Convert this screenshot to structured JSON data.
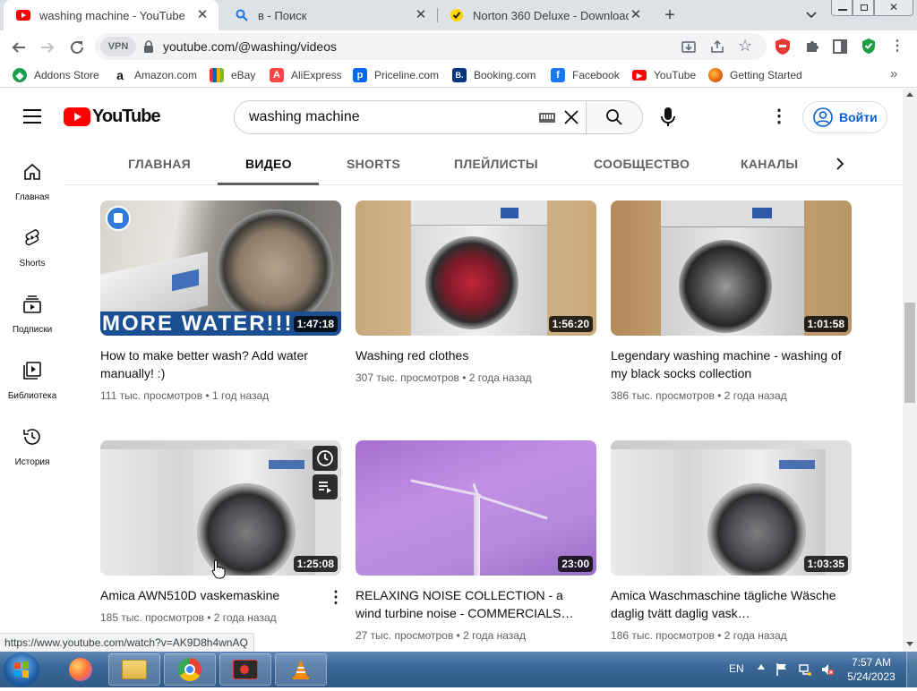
{
  "browser": {
    "tabs": [
      {
        "title": "washing machine - YouTube",
        "active": true
      },
      {
        "title": "в - Поиск",
        "active": false
      },
      {
        "title": "Norton 360 Deluxe - Download",
        "active": false
      }
    ],
    "new_tab": "+",
    "url": "youtube.com/@washing/videos",
    "vpn_label": "VPN",
    "bookmarks": [
      {
        "label": "Addons Store",
        "color": "#1a9e4b",
        "glyph": "◆"
      },
      {
        "label": "Amazon.com",
        "color": "#111111",
        "glyph": "a"
      },
      {
        "label": "eBay",
        "color": "#e53238",
        "glyph": "e"
      },
      {
        "label": "AliExpress",
        "color": "#ff4747",
        "glyph": "A"
      },
      {
        "label": "Priceline.com",
        "color": "#0068ef",
        "glyph": "p"
      },
      {
        "label": "Booking.com",
        "color": "#003580",
        "glyph": "B."
      },
      {
        "label": "Facebook",
        "color": "#1877f2",
        "glyph": "f"
      },
      {
        "label": "YouTube",
        "color": "#ff0000",
        "glyph": "▶"
      },
      {
        "label": "Getting Started",
        "color": "#e66000",
        "glyph": "●"
      }
    ],
    "bookmarks_more": "»",
    "status_url": "https://www.youtube.com/watch?v=AK9D8h4wnAQ"
  },
  "youtube": {
    "logo_text": "YouTube",
    "search_value": "washing machine",
    "signin_label": "Войти",
    "channel_tabs": [
      "ГЛАВНАЯ",
      "ВИДЕО",
      "SHORTS",
      "ПЛЕЙЛИСТЫ",
      "СООБЩЕСТВО",
      "КАНАЛЫ"
    ],
    "guide": [
      {
        "label": "Главная",
        "icon": "home-icon"
      },
      {
        "label": "Shorts",
        "icon": "shorts-icon"
      },
      {
        "label": "Подписки",
        "icon": "subscriptions-icon"
      },
      {
        "label": "Библиотека",
        "icon": "library-icon"
      },
      {
        "label": "История",
        "icon": "history-icon"
      }
    ],
    "videos": [
      {
        "title": "How to make better wash? Add water manually! :)",
        "views": "111 тыс. просмотров",
        "age": "1 год назад",
        "duration": "1:47:18",
        "overlay": "MORE WATER!!!"
      },
      {
        "title": "Washing red clothes",
        "views": "307 тыс. просмотров",
        "age": "2 года назад",
        "duration": "1:56:20"
      },
      {
        "title": "Legendary washing machine - washing of my black socks collection",
        "views": "386 тыс. просмотров",
        "age": "2 года назад",
        "duration": "1:01:58"
      },
      {
        "title": "Amica AWN510D vaskemaskine",
        "views": "185 тыс. просмотров",
        "age": "2 года назад",
        "duration": "1:25:08"
      },
      {
        "title": "RELAXING NOISE COLLECTION - a wind turbine noise - COMMERCIALS…",
        "views": "27 тыс. просмотров",
        "age": "2 года назад",
        "duration": "23:00"
      },
      {
        "title": "Amica Waschmaschine tägliche Wäsche daglig tvätt daglig vask…",
        "views": "186 тыс. просмотров",
        "age": "2 года назад",
        "duration": "1:03:35"
      }
    ]
  },
  "taskbar": {
    "lang": "EN",
    "time": "7:57 AM",
    "date": "5/24/2023"
  }
}
